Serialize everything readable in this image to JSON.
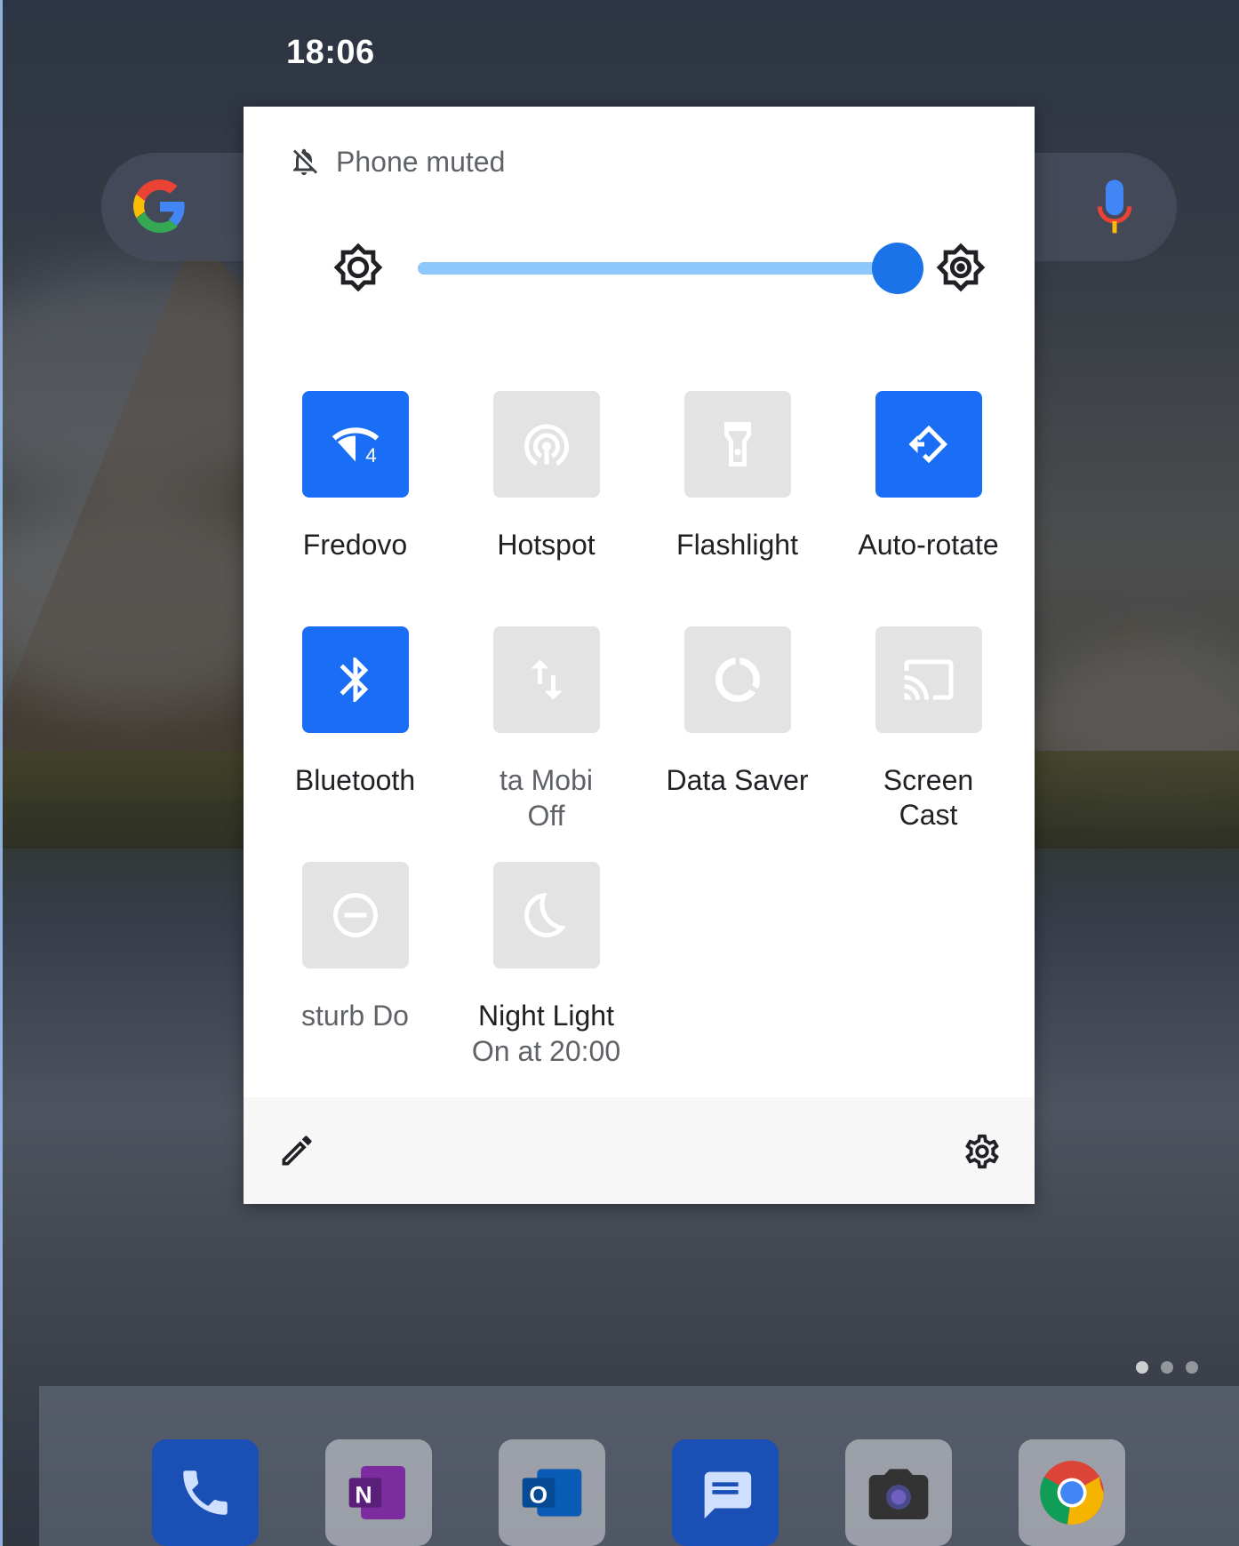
{
  "status_bar": {
    "time": "18:06"
  },
  "notification_header": {
    "text": "Phone muted",
    "icon": "bell-off-icon"
  },
  "brightness": {
    "level_percent": 100,
    "icon_low": "brightness-low-icon",
    "icon_high": "brightness-high-icon"
  },
  "tiles": [
    {
      "label": "Fredovo",
      "sub": "",
      "state": "on",
      "icon": "wifi-icon",
      "badge": "4"
    },
    {
      "label": "Hotspot",
      "sub": "",
      "state": "off",
      "icon": "hotspot-icon"
    },
    {
      "label": "Flashlight",
      "sub": "",
      "state": "off",
      "icon": "flashlight-icon"
    },
    {
      "label": "Auto-rotate",
      "sub": "",
      "state": "on",
      "icon": "auto-rotate-icon"
    },
    {
      "label": "Bluetooth",
      "sub": "",
      "state": "on",
      "icon": "bluetooth-icon"
    },
    {
      "label": "ta      Mobi",
      "sub": "Off",
      "state": "off",
      "icon": "mobile-data-icon"
    },
    {
      "label": "Data Saver",
      "sub": "",
      "state": "off",
      "icon": "data-saver-icon"
    },
    {
      "label": "Screen",
      "label2": "Cast",
      "state": "off",
      "icon": "screen-cast-icon"
    },
    {
      "label": "sturb      Do",
      "sub": "",
      "state": "off",
      "icon": "do-not-disturb-icon"
    },
    {
      "label": "Night Light",
      "sub": "On at 20:00",
      "state": "off",
      "icon": "night-light-icon"
    }
  ],
  "footer": {
    "edit_icon": "edit-icon",
    "settings_icon": "settings-icon"
  },
  "colors": {
    "tile_on": "#1a6ef5",
    "tile_off": "#e3e3e3",
    "slider_fill": "#8ec7fa",
    "slider_thumb": "#1a73e8"
  },
  "dock": {
    "apps": [
      "phone-app-icon",
      "onenote-app-icon",
      "outlook-app-icon",
      "messages-app-icon",
      "camera-app-icon",
      "chrome-app-icon"
    ]
  }
}
